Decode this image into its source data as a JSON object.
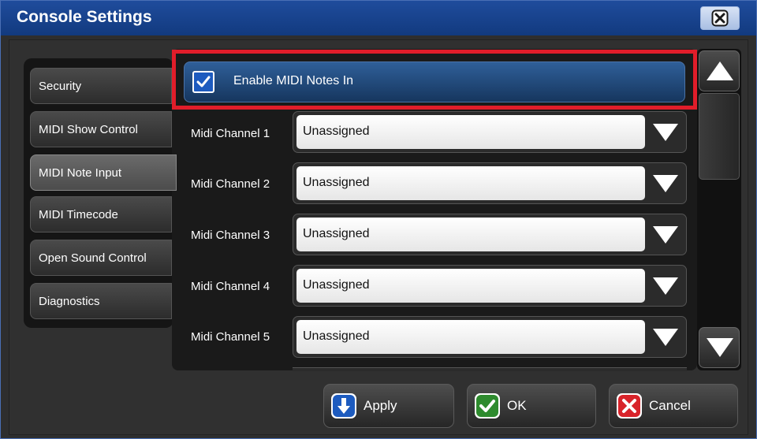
{
  "window": {
    "title": "Console Settings"
  },
  "tabs": [
    {
      "label": "Security",
      "active": false
    },
    {
      "label": "MIDI Show Control",
      "active": false
    },
    {
      "label": "MIDI Note Input",
      "active": true
    },
    {
      "label": "MIDI Timecode",
      "active": false
    },
    {
      "label": "Open Sound Control",
      "active": false
    },
    {
      "label": "Diagnostics",
      "active": false
    }
  ],
  "enable": {
    "label": "Enable MIDI Notes In",
    "checked": true
  },
  "channels": [
    {
      "label": "Midi Channel 1",
      "value": "Unassigned"
    },
    {
      "label": "Midi Channel 2",
      "value": "Unassigned"
    },
    {
      "label": "Midi Channel 3",
      "value": "Unassigned"
    },
    {
      "label": "Midi Channel 4",
      "value": "Unassigned"
    },
    {
      "label": "Midi Channel 5",
      "value": "Unassigned"
    }
  ],
  "footer": {
    "apply": "Apply",
    "ok": "OK",
    "cancel": "Cancel"
  },
  "colors": {
    "title_bar": "#1f4c9c",
    "highlight": "#e11d2a",
    "apply_icon": "#1d5bbf",
    "ok_icon": "#2e8b2e",
    "cancel_icon": "#d8232a"
  }
}
